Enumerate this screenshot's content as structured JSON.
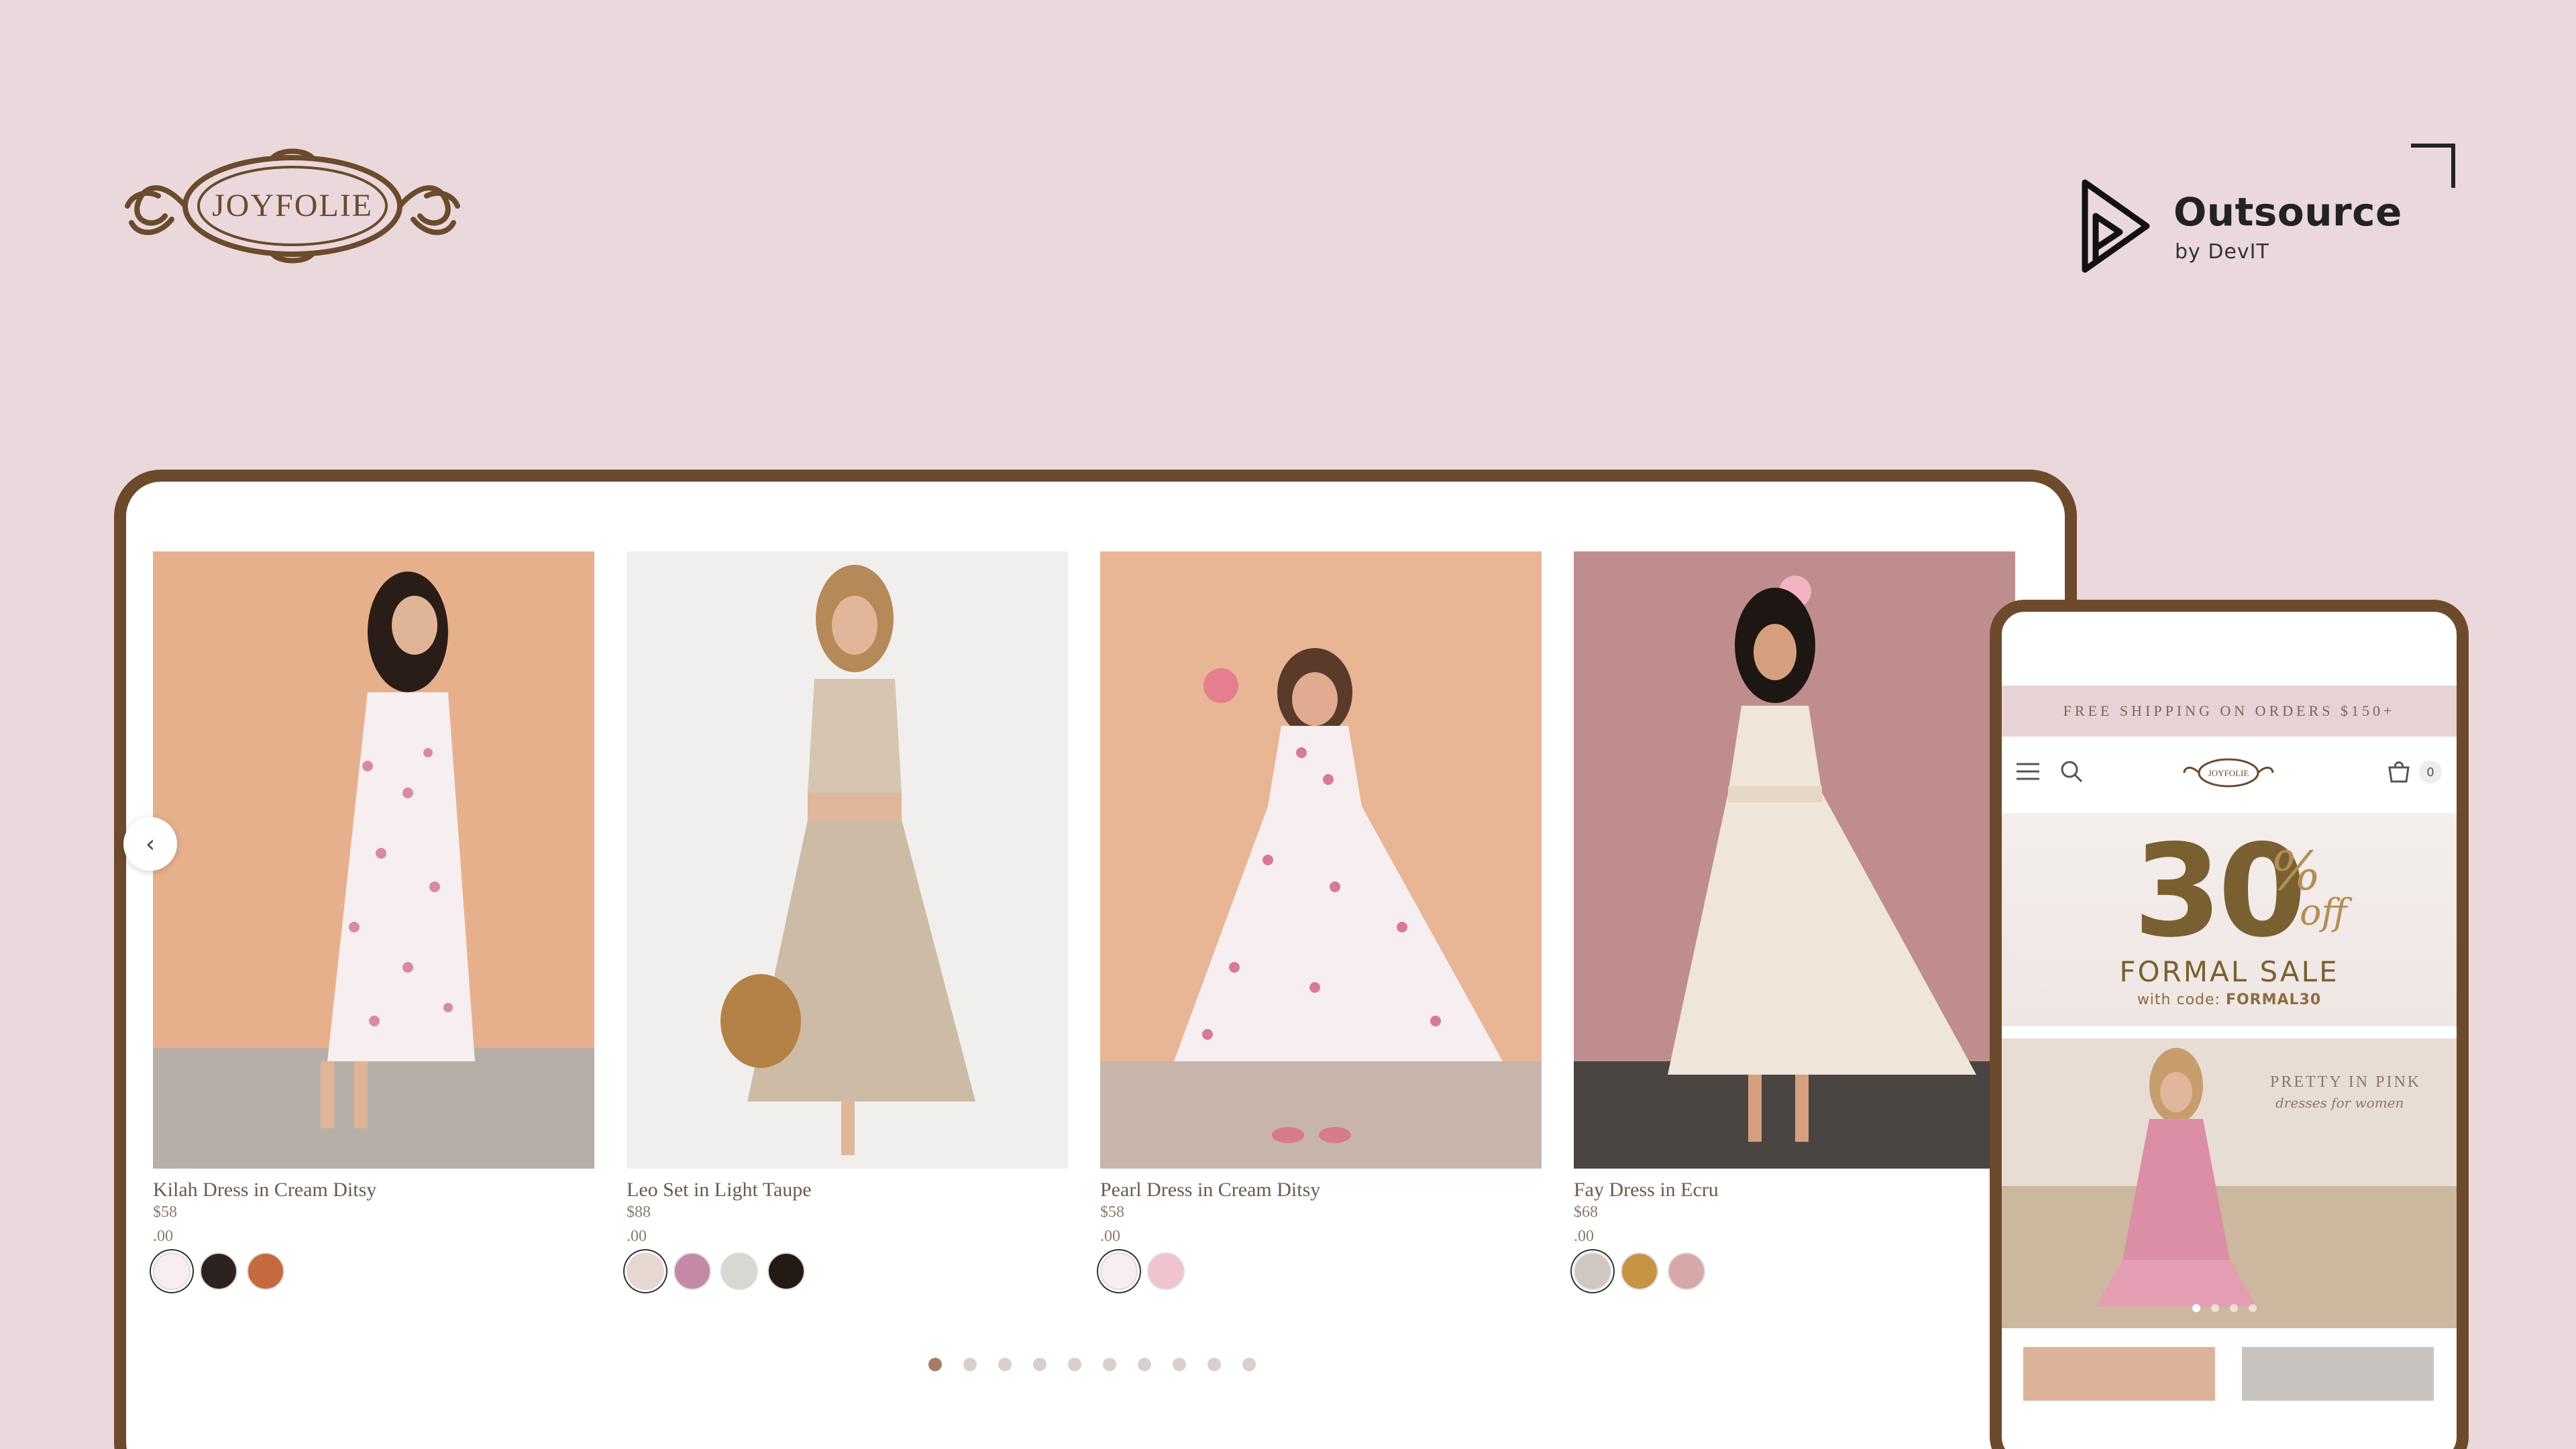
{
  "brand": {
    "logo_text": "JOYFOLIE"
  },
  "partner": {
    "name": "Outsource",
    "sub": "by DevIT"
  },
  "products": [
    {
      "name": "Kilah Dress in Cream Ditsy",
      "price": "$58",
      "cents": ".00",
      "swatches": [
        "#f7eef0",
        "#2b2320",
        "#c46a3e"
      ]
    },
    {
      "name": "Leo Set in Light Taupe",
      "price": "$88",
      "cents": ".00",
      "swatches": [
        "#e6d8cf",
        "#c48aa5",
        "#d9d7d2",
        "#231a14"
      ]
    },
    {
      "name": "Pearl Dress in Cream Ditsy",
      "price": "$58",
      "cents": ".00",
      "swatches": [
        "#f6eef0",
        "#f0c4cf"
      ]
    },
    {
      "name": "Fay Dress in Ecru",
      "price": "$68",
      "cents": ".00",
      "swatches": [
        "#cfc8c2",
        "#c79444",
        "#d8a8a8"
      ]
    }
  ],
  "carousel": {
    "prev_icon": "‹",
    "dots": 10,
    "active_dot": 0
  },
  "mobile": {
    "shipping_banner": "FREE SHIPPING ON ORDERS $150+",
    "cart_count": "0",
    "logo_text": "JOYFOLIE",
    "promo": {
      "percent": "30",
      "symbol": "%",
      "off": "off",
      "title": "FORMAL SALE",
      "code_prefix": "with code: ",
      "code": "FORMAL30"
    },
    "hero": {
      "title": "PRETTY IN PINK",
      "subtitle": "dresses for women",
      "dots": 4,
      "active_dot": 0
    }
  },
  "colors": {
    "background": "#ebd8dc",
    "frame": "#6e4a2c",
    "accent": "#a87a6a",
    "promo_gold": "#7a6030"
  },
  "icons": {
    "carousel_prev": "chevron-left-icon",
    "menu": "hamburger-icon",
    "search": "search-icon",
    "cart": "shopping-bag-icon"
  }
}
